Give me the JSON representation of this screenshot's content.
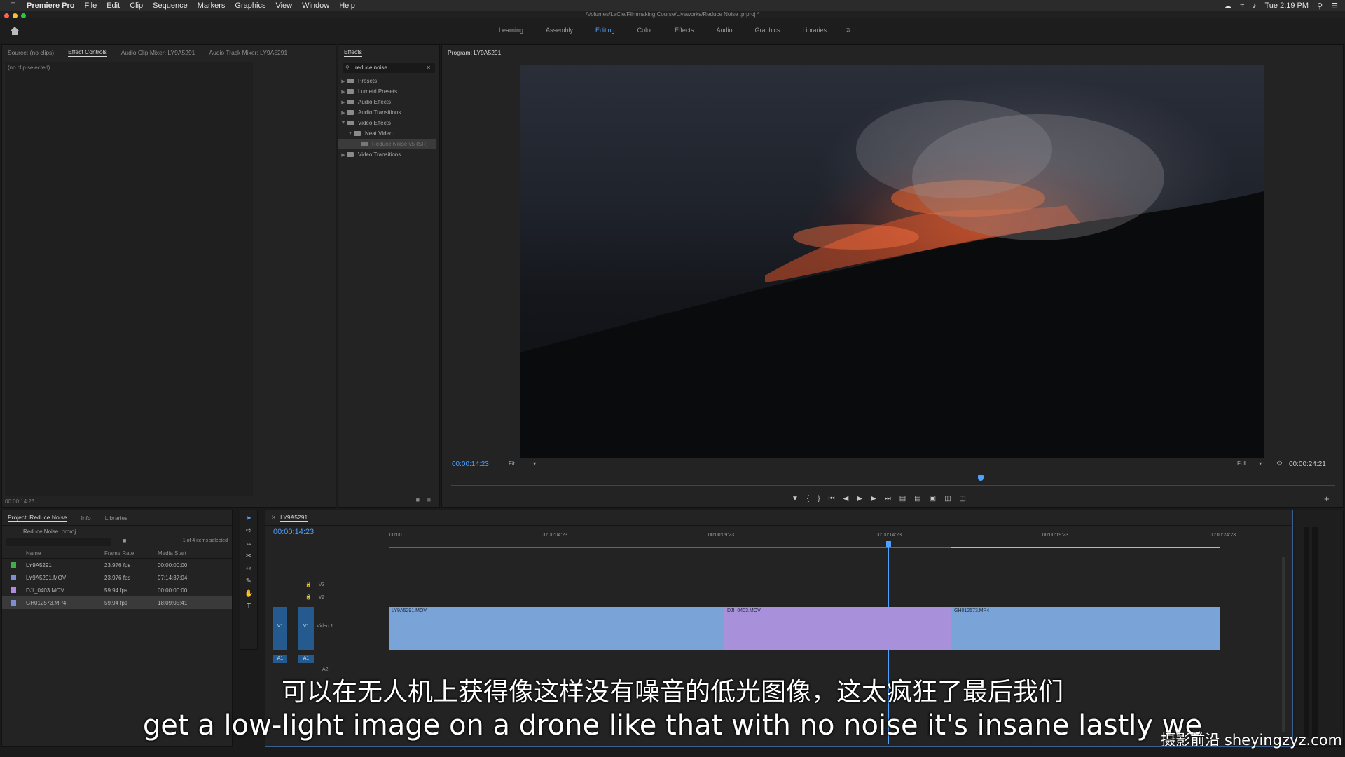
{
  "menubar": {
    "app_name": "Premiere Pro",
    "items": [
      "File",
      "Edit",
      "Clip",
      "Sequence",
      "Markers",
      "Graphics",
      "View",
      "Window",
      "Help"
    ],
    "clock": "Tue 2:19 PM"
  },
  "window_title": "/Volumes/LaCie/Filmmaking Course/Liveworks/Reduce Noise .prproj *",
  "workspaces": {
    "tabs": [
      "Learning",
      "Assembly",
      "Editing",
      "Color",
      "Effects",
      "Audio",
      "Graphics",
      "Libraries"
    ],
    "active": "Editing"
  },
  "source_panel": {
    "tabs": [
      "Source: (no clips)",
      "Effect Controls",
      "Audio Clip Mixer: LY9A5291",
      "Audio Track Mixer: LY9A5291"
    ],
    "active_tab": "Effect Controls",
    "status": "(no clip selected)",
    "timecode": "00:00:14:23"
  },
  "effects_panel": {
    "title": "Effects",
    "search_value": "reduce noise",
    "tree": [
      {
        "label": "Presets",
        "level": 0,
        "open": false
      },
      {
        "label": "Lumetri Presets",
        "level": 0,
        "open": false
      },
      {
        "label": "Audio Effects",
        "level": 0,
        "open": false
      },
      {
        "label": "Audio Transitions",
        "level": 0,
        "open": false
      },
      {
        "label": "Video Effects",
        "level": 0,
        "open": true
      },
      {
        "label": "Neat Video",
        "level": 1,
        "open": true
      },
      {
        "label": "Reduce Noise v5 (SR)",
        "level": 2,
        "selected": true
      },
      {
        "label": "Video Transitions",
        "level": 0,
        "open": false
      }
    ]
  },
  "program_monitor": {
    "title": "Program: LY9A5291",
    "timecode": "00:00:14:23",
    "fit": "Fit",
    "quality": "Full",
    "duration": "00:00:24:21"
  },
  "project_panel": {
    "tabs": [
      "Project: Reduce Noise",
      "Info",
      "Libraries"
    ],
    "active_tab": "Project: Reduce Noise",
    "file": "Reduce Noise .prproj",
    "selection_status": "1 of 4 items selected",
    "columns": [
      "Name",
      "Frame Rate",
      "Media Start"
    ],
    "rows": [
      {
        "name": "LY9A5291",
        "frame_rate": "23.976 fps",
        "media_start": "00:00:00:00",
        "color": "#3fae49"
      },
      {
        "name": "LY9A5291.MOV",
        "frame_rate": "23.976 fps",
        "media_start": "07:14:37:04",
        "color": "#7b8fd6"
      },
      {
        "name": "DJI_0403.MOV",
        "frame_rate": "59.94 fps",
        "media_start": "00:00:00:00",
        "color": "#b08adf"
      },
      {
        "name": "GH012573.MP4",
        "frame_rate": "59.94 fps",
        "media_start": "18:09:05:41",
        "color": "#7b8fd6",
        "selected": true
      }
    ]
  },
  "timeline": {
    "sequence_name": "LY9A5291",
    "timecode": "00:00:14:23",
    "ruler": [
      "00:00",
      "00:00:04:23",
      "00:00:09:23",
      "00:00:14:23",
      "00:00:19:23",
      "00:00:24:23"
    ],
    "tracks": [
      "V3",
      "V2",
      "V1",
      "A1",
      "A2"
    ],
    "v1_name": "Video 1",
    "clips": [
      {
        "name": "LY9A5291.MOV",
        "color": "#7aa4d8"
      },
      {
        "name": "DJI_0403.MOV",
        "color": "#a990db"
      },
      {
        "name": "GH012573.MP4",
        "color": "#7aa4d8"
      }
    ]
  },
  "subtitles": {
    "chinese": "可以在无人机上获得像这样没有噪音的低光图像，这太疯狂了最后我们",
    "english": "get a low-light image on a drone like that with no noise it's insane lastly we"
  },
  "watermark": "摄影前沿 sheyingzyz.com"
}
